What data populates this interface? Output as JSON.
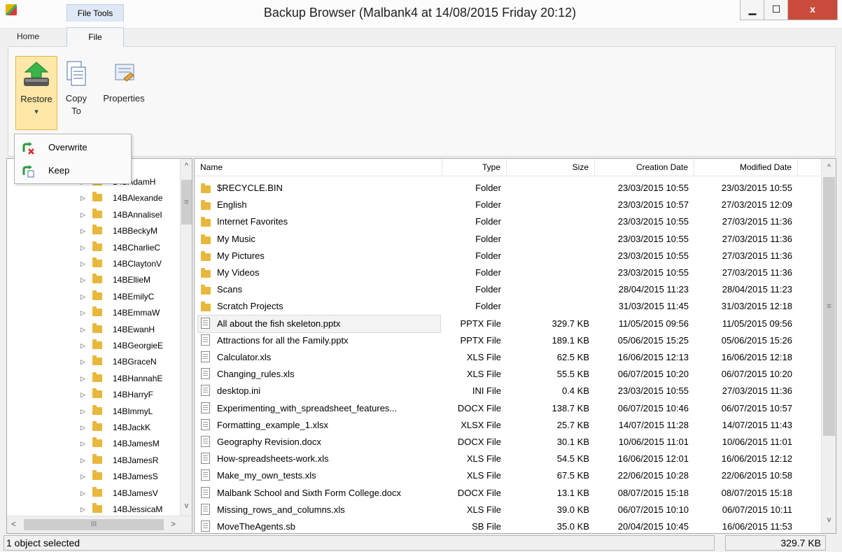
{
  "window": {
    "title": "Backup Browser (Malbank4 at 14/08/2015 Friday 20:12)",
    "minimize": "▁",
    "maximize": "☐",
    "close": "x"
  },
  "ribbon": {
    "context_tab": "File Tools",
    "tabs": [
      {
        "label": "Home"
      },
      {
        "label": "File"
      }
    ],
    "buttons": {
      "restore": "Restore",
      "restore_arrow": "▾",
      "copy_to": "Copy\nTo",
      "properties": "Properties"
    },
    "restore_menu": [
      {
        "label": "Overwrite"
      },
      {
        "label": "Keep"
      }
    ]
  },
  "tree": {
    "items": [
      "14BAdamH",
      "14BAlexande",
      "14BAnnaliseI",
      "14BBeckyM",
      "14BCharlieC",
      "14BClaytonV",
      "14BEllieM",
      "14BEmilyC",
      "14BEmmaW",
      "14BEwanH",
      "14BGeorgieE",
      "14BGraceN",
      "14BHannahE",
      "14BHarryF",
      "14BImmyL",
      "14BJackK",
      "14BJamesM",
      "14BJamesR",
      "14BJamesS",
      "14BJamesV",
      "14BJessicaM"
    ],
    "scroll_left": "<",
    "scroll_right": ">",
    "scroll_thumb": "III",
    "scroll_up": "^",
    "scroll_down": "v",
    "grip": "≡"
  },
  "list": {
    "columns": {
      "name": "Name",
      "type": "Type",
      "size": "Size",
      "created": "Creation Date",
      "modified": "Modified Date"
    },
    "scroll_up": "^",
    "scroll_down": "v",
    "grip": "≡",
    "rows": [
      {
        "name": "$RECYCLE.BIN",
        "type": "Folder",
        "size": "",
        "created": "23/03/2015 10:55",
        "modified": "23/03/2015 10:55",
        "icon": "folder"
      },
      {
        "name": "English",
        "type": "Folder",
        "size": "",
        "created": "23/03/2015 10:57",
        "modified": "27/03/2015 12:09",
        "icon": "folder"
      },
      {
        "name": "Internet Favorites",
        "type": "Folder",
        "size": "",
        "created": "23/03/2015 10:55",
        "modified": "27/03/2015 11:36",
        "icon": "folder"
      },
      {
        "name": "My Music",
        "type": "Folder",
        "size": "",
        "created": "23/03/2015 10:55",
        "modified": "27/03/2015 11:36",
        "icon": "folder"
      },
      {
        "name": "My Pictures",
        "type": "Folder",
        "size": "",
        "created": "23/03/2015 10:55",
        "modified": "27/03/2015 11:36",
        "icon": "folder"
      },
      {
        "name": "My Videos",
        "type": "Folder",
        "size": "",
        "created": "23/03/2015 10:55",
        "modified": "27/03/2015 11:36",
        "icon": "folder"
      },
      {
        "name": "Scans",
        "type": "Folder",
        "size": "",
        "created": "28/04/2015 11:23",
        "modified": "28/04/2015 11:23",
        "icon": "folder"
      },
      {
        "name": "Scratch Projects",
        "type": "Folder",
        "size": "",
        "created": "31/03/2015 11:45",
        "modified": "31/03/2015 12:18",
        "icon": "folder"
      },
      {
        "name": "All about the fish skeleton.pptx",
        "type": "PPTX File",
        "size": "329.7 KB",
        "created": "11/05/2015 09:56",
        "modified": "11/05/2015 09:56",
        "icon": "file",
        "selected": true
      },
      {
        "name": "Attractions for all the Family.pptx",
        "type": "PPTX File",
        "size": "189.1 KB",
        "created": "05/06/2015 15:25",
        "modified": "05/06/2015 15:26",
        "icon": "file"
      },
      {
        "name": "Calculator.xls",
        "type": "XLS File",
        "size": "62.5 KB",
        "created": "16/06/2015 12:13",
        "modified": "16/06/2015 12:18",
        "icon": "file"
      },
      {
        "name": "Changing_rules.xls",
        "type": "XLS File",
        "size": "55.5 KB",
        "created": "06/07/2015 10:20",
        "modified": "06/07/2015 10:20",
        "icon": "file"
      },
      {
        "name": "desktop.ini",
        "type": "INI File",
        "size": "0.4 KB",
        "created": "23/03/2015 10:55",
        "modified": "27/03/2015 11:36",
        "icon": "file"
      },
      {
        "name": "Experimenting_with_spreadsheet_features...",
        "type": "DOCX File",
        "size": "138.7 KB",
        "created": "06/07/2015 10:46",
        "modified": "06/07/2015 10:57",
        "icon": "file"
      },
      {
        "name": "Formatting_example_1.xlsx",
        "type": "XLSX File",
        "size": "25.7 KB",
        "created": "14/07/2015 11:28",
        "modified": "14/07/2015 11:43",
        "icon": "file"
      },
      {
        "name": "Geography Revision.docx",
        "type": "DOCX File",
        "size": "30.1 KB",
        "created": "10/06/2015 11:01",
        "modified": "10/06/2015 11:01",
        "icon": "file"
      },
      {
        "name": "How-spreadsheets-work.xls",
        "type": "XLS File",
        "size": "54.5 KB",
        "created": "16/06/2015 12:01",
        "modified": "16/06/2015 12:12",
        "icon": "file"
      },
      {
        "name": "Make_my_own_tests.xls",
        "type": "XLS File",
        "size": "67.5 KB",
        "created": "22/06/2015 10:28",
        "modified": "22/06/2015 10:58",
        "icon": "file"
      },
      {
        "name": "Malbank School and Sixth Form College.docx",
        "type": "DOCX File",
        "size": "13.1 KB",
        "created": "08/07/2015 15:18",
        "modified": "08/07/2015 15:18",
        "icon": "file"
      },
      {
        "name": "Missing_rows_and_columns.xls",
        "type": "XLS File",
        "size": "39.0 KB",
        "created": "06/07/2015 10:10",
        "modified": "06/07/2015 10:11",
        "icon": "file"
      },
      {
        "name": "MoveTheAgents.sb",
        "type": "SB File",
        "size": "35.0 KB",
        "created": "20/04/2015 10:45",
        "modified": "16/06/2015 11:53",
        "icon": "file"
      }
    ]
  },
  "status": {
    "left": "1 object selected",
    "right": "329.7 KB"
  },
  "colors": {
    "restore_highlight": "#fde8a8",
    "folder": "#e8b83d",
    "close": "#c94b3b"
  }
}
